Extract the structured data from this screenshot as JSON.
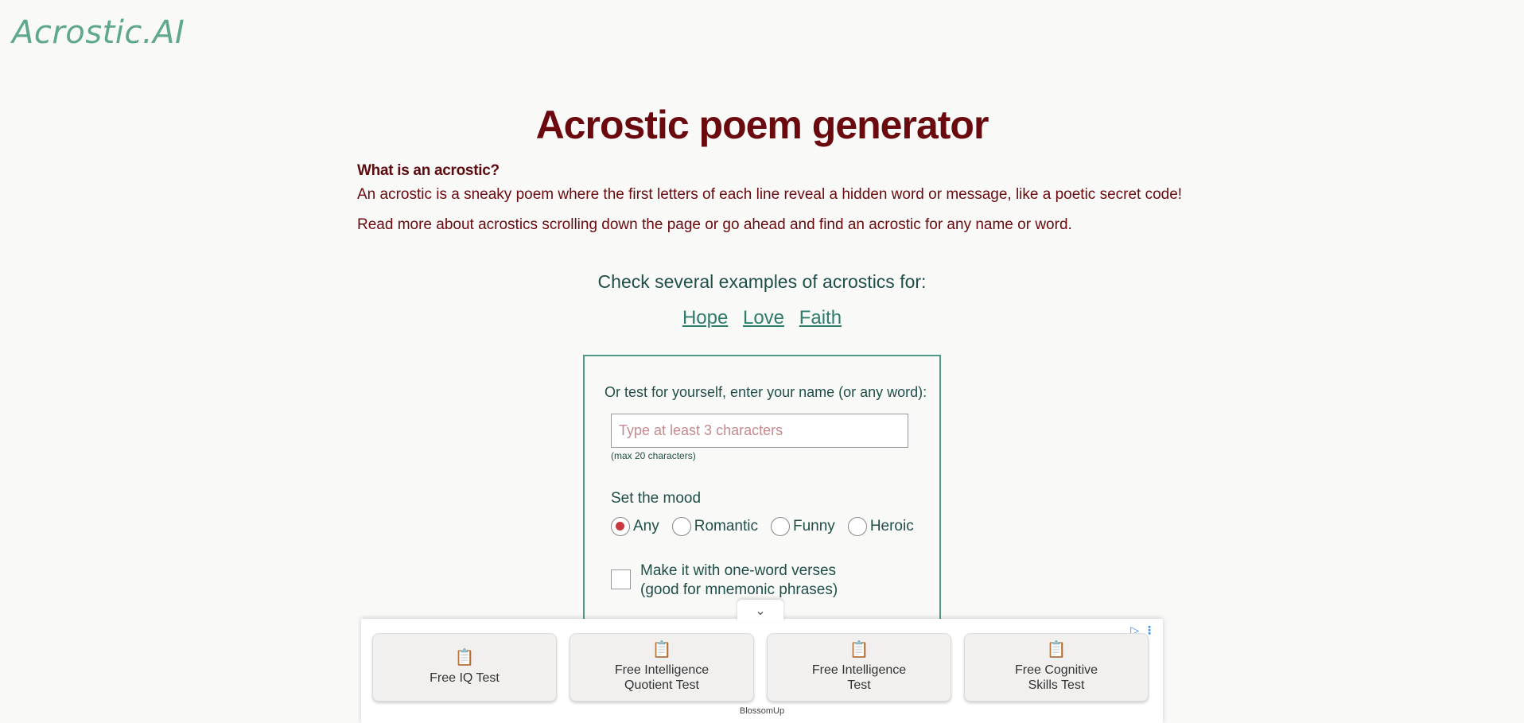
{
  "header": {
    "logo": "Acrostic.AI"
  },
  "main": {
    "title": "Acrostic poem generator",
    "intro_heading": "What is an acrostic?",
    "intro_p1": "An acrostic is a sneaky poem where the first letters of each line reveal a hidden word or message, like a poetic secret code!",
    "intro_p2": "Read more about acrostics scrolling down the page or go ahead and find an acrostic for any name or word.",
    "examples_heading": "Check several examples of acrostics for:",
    "examples": [
      "Hope",
      "Love",
      "Faith"
    ]
  },
  "form": {
    "prompt": "Or test for yourself, enter your name (or any word):",
    "input_placeholder": "Type at least 3 characters",
    "input_value": "",
    "max_note": "(max 20 characters)",
    "mood_label": "Set the mood",
    "moods": [
      "Any",
      "Romantic",
      "Funny",
      "Heroic"
    ],
    "selected_mood": "Any",
    "one_word_label_line1": "Make it with one-word verses",
    "one_word_label_line2": "(good for mnemonic phrases)",
    "one_word_checked": false
  },
  "ad": {
    "toggle_icon": "chevron-down-icon",
    "cards": [
      {
        "label": "Free IQ Test",
        "icon": "clipboard-icon"
      },
      {
        "label": "Free Intelligence\nQuotient Test",
        "icon": "clipboard-icon"
      },
      {
        "label": "Free Intelligence\nTest",
        "icon": "clipboard-icon"
      },
      {
        "label": "Free Cognitive\nSkills Test",
        "icon": "clipboard-icon"
      }
    ],
    "brand": "BlossomUp"
  },
  "colors": {
    "title": "#6a0a0e",
    "logo": "#5fa88e",
    "link": "#2e7d6a",
    "form_border": "#4f9a84",
    "radio_selected": "#c9383f",
    "ad_icon": "#d23a3a"
  }
}
